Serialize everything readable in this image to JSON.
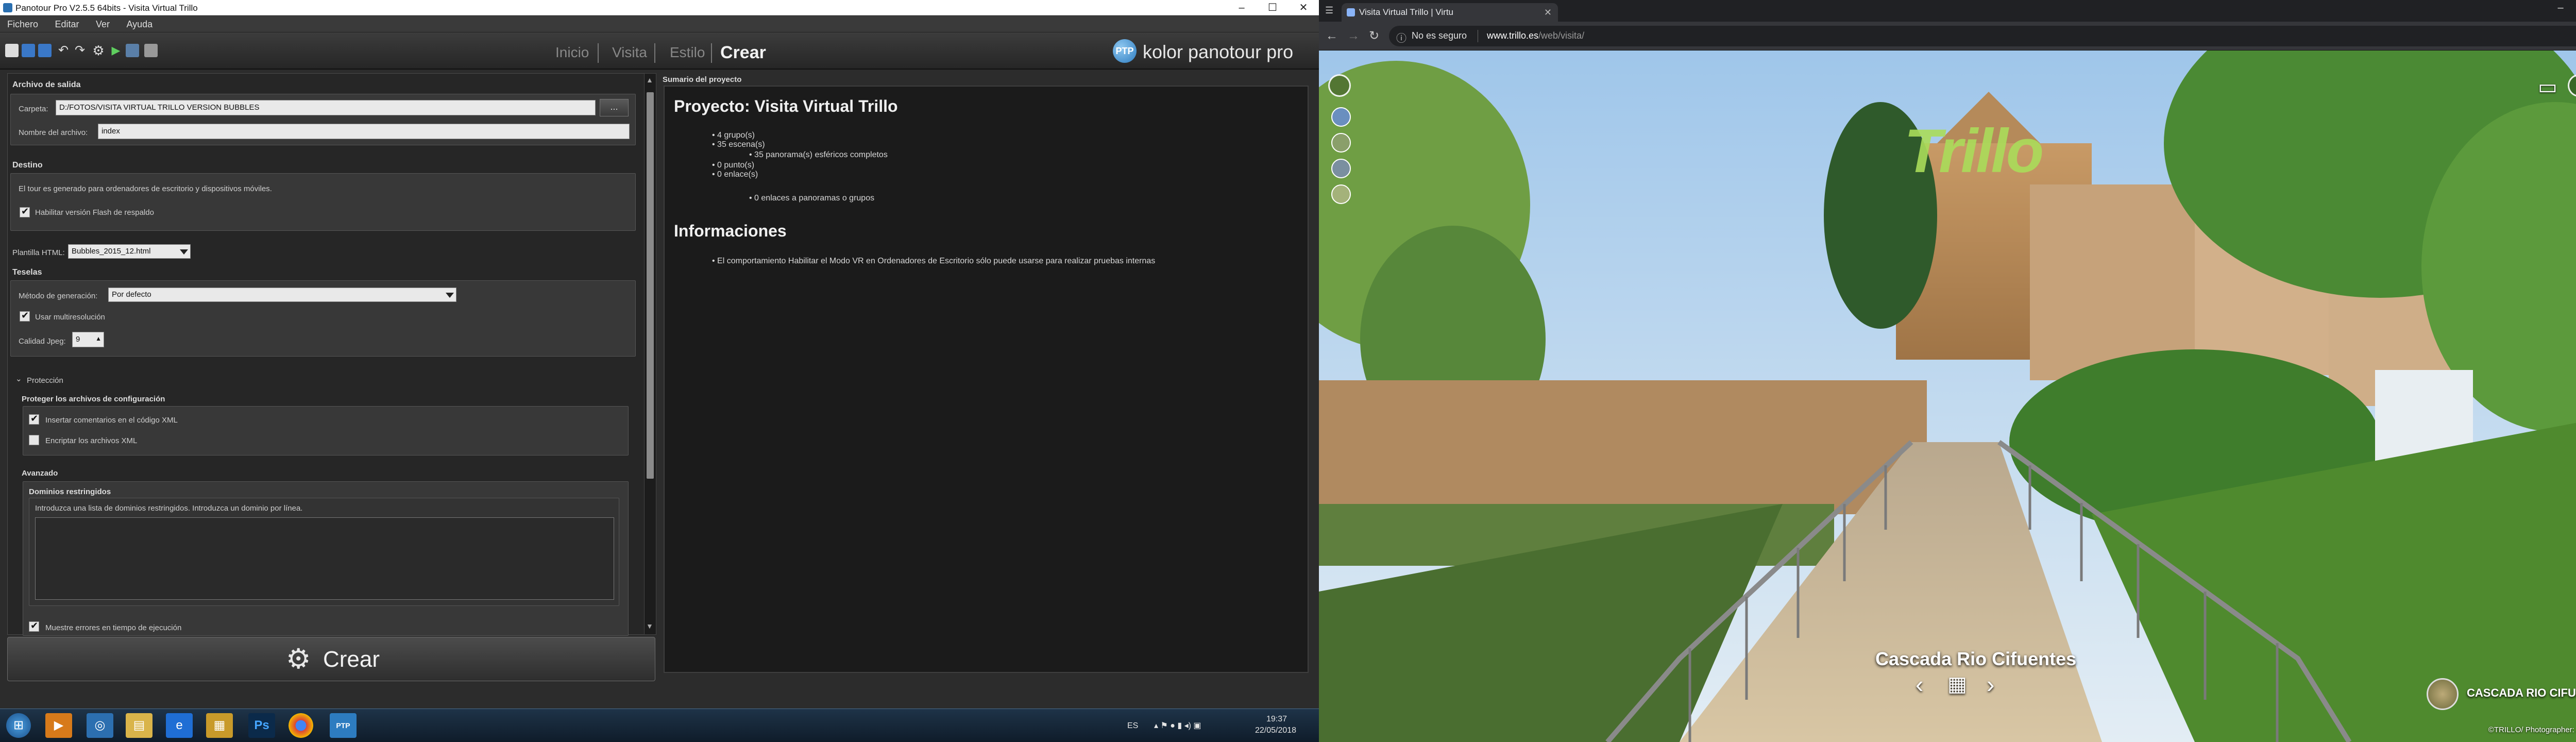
{
  "panotour": {
    "window_title": "Panotour Pro V2.5.5 64bits - Visita Virtual Trillo",
    "menu": [
      "Fichero",
      "Editar",
      "Ver",
      "Ayuda"
    ],
    "nav_tabs": [
      "Inicio",
      "Visita",
      "Estilo",
      "Crear"
    ],
    "active_tab": "Crear",
    "logo_badge": "PTP",
    "logo_text": "kolor panotour pro",
    "output": {
      "header": "Archivo de salida",
      "folder_label": "Carpeta:",
      "folder_value": "D:/FOTOS/VISITA VIRTUAL TRILLO VERSION BUBBLES",
      "browse_label": "...",
      "filename_label": "Nombre del archivo:",
      "filename_value": "index"
    },
    "destination": {
      "header": "Destino",
      "description": "El tour es generado para ordenadores de escritorio y dispositivos móviles.",
      "flash_label": "Habilitar versión Flash de respaldo",
      "flash_checked": true
    },
    "template": {
      "label": "Plantilla HTML:",
      "value": "Bubbles_2015_12.html"
    },
    "tiles": {
      "header": "Teselas",
      "method_label": "Método de generación:",
      "method_value": "Por defecto",
      "multires_label": "Usar multiresolución",
      "multires_checked": true,
      "quality_label": "Calidad Jpeg:",
      "quality_value": "9"
    },
    "protection": {
      "header": "Protección",
      "subheader": "Proteger los archivos de configuración",
      "comments_label": "Insertar comentarios en el código XML",
      "comments_checked": true,
      "encrypt_label": "Encriptar los archivos XML",
      "encrypt_checked": false
    },
    "advanced": {
      "header": "Avanzado",
      "domains_header": "Dominios restringidos",
      "domains_hint": "Introduzca una lista de dominios restringidos. Introduzca un dominio por línea.",
      "errors_label": "Muestre errores en tiempo de ejecución",
      "errors_checked": true
    },
    "create_button": "Crear",
    "summary": {
      "header": "Sumario del proyecto",
      "project_title": "Proyecto: Visita Virtual Trillo",
      "items": [
        "• 4 grupo(s)",
        "• 35 escena(s)",
        "• 35 panorama(s) esféricos completos",
        "• 0 punto(s)",
        "• 0 enlace(s)",
        "• 0 enlaces a panoramas o grupos"
      ],
      "info_title": "Informaciones",
      "info_items": [
        "• El comportamiento Habilitar el Modo VR en Ordenadores de Escritorio sólo puede usarse para realizar pruebas internas"
      ]
    },
    "taskbar": {
      "lang": "ES",
      "time": "19:37",
      "date": "22/05/2018"
    }
  },
  "browser": {
    "tab_title": "Visita Virtual Trillo | Virtu",
    "security_text": "No es seguro",
    "url_domain": "www.trillo.es",
    "url_path": "/web/visita/",
    "logo_text": "Trillo",
    "scene_title": "Cascada Rio Cifuentes",
    "thumb_label": "CASCADA RIO CIFUEN...",
    "credit": "©TRILLO/ Photographer: Alberto Cerrada"
  },
  "colors": {
    "panotour_bg": "#2c2c2c",
    "accent_blue": "#2d7cc0",
    "taskbar": "#0f1c2a"
  }
}
